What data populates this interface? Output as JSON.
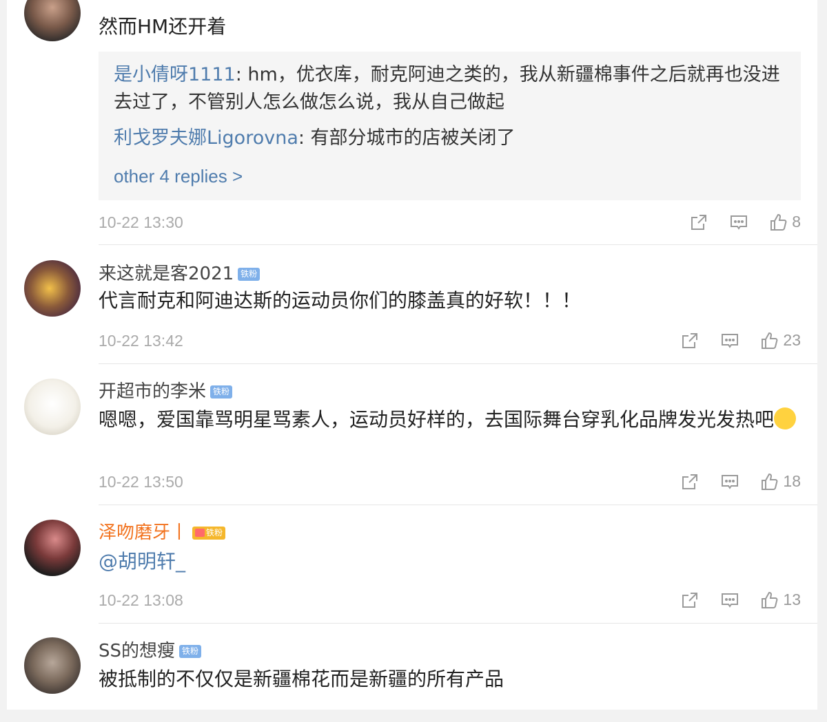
{
  "comments": [
    {
      "text": "然而HM还开着",
      "replies": [
        {
          "user": "是小倩呀1111",
          "text": ": hm，优衣库，耐克阿迪之类的，我从新疆棉事件之后就再也没进去过了，不管别人怎么做怎么说，我从自己做起"
        },
        {
          "user": "利戈罗夫娜Ligorovna",
          "text": ": 有部分城市的店被关闭了"
        }
      ],
      "more_replies": "other 4 replies >",
      "time": "10-22 13:30",
      "likes": "8"
    },
    {
      "user": "来这就是客2021",
      "badge": "铁粉",
      "text": "代言耐克和阿迪达斯的运动员你们的膝盖真的好软！！！",
      "time": "10-22 13:42",
      "likes": "23"
    },
    {
      "user": "开超市的李米",
      "badge": "铁粉",
      "text": "嗯嗯，爱国靠骂明星骂素人，运动员好样的，去国际舞台穿乳化品牌发光发热吧",
      "time": "10-22 13:50",
      "likes": "18"
    },
    {
      "user": "泽吻磨牙丨",
      "badge": "铁粉",
      "text": "@胡明轩_",
      "time": "10-22 13:08",
      "likes": "13"
    },
    {
      "user": "SS的想瘦",
      "badge": "铁粉",
      "text": "被抵制的不仅仅是新疆棉花而是新疆的所有产品"
    }
  ],
  "colors": {
    "link": "#4f7cad",
    "vip_name": "#f2731f",
    "badge": "#7fb0ea"
  },
  "icons": {
    "share": "share-icon",
    "comment": "comment-icon",
    "like": "thumbs-up-icon"
  }
}
